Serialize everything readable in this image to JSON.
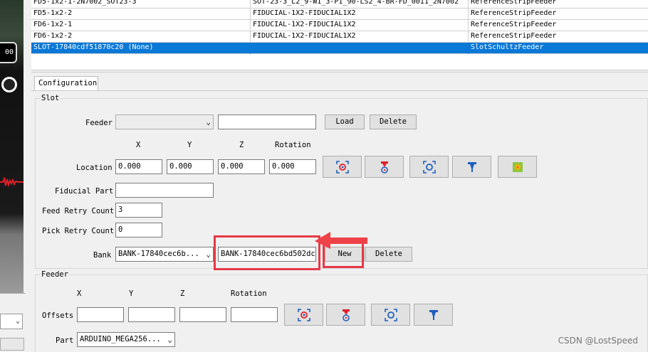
{
  "camera": {
    "zoom_label": "00"
  },
  "feeder_table": {
    "rows": [
      {
        "name": "FD5-1x2-1-2N7002_SOT23-3",
        "part": "SOT-23-3_L2_9-W1_3-P1_90-LS2_4-BR-FD_0011_2N7002",
        "type": "ReferenceStripFeeder",
        "selected": false
      },
      {
        "name": "FD5-1x2-2",
        "part": "FIDUCIAL-1X2-FIDUCIAL1X2",
        "type": "ReferenceStripFeeder",
        "selected": false
      },
      {
        "name": "FD6-1x2-1",
        "part": "FIDUCIAL-1X2-FIDUCIAL1X2",
        "type": "ReferenceStripFeeder",
        "selected": false
      },
      {
        "name": "FD6-1x2-2",
        "part": "FIDUCIAL-1X2-FIDUCIAL1X2",
        "type": "ReferenceStripFeeder",
        "selected": false
      },
      {
        "name": "SLOT-17840cdf51870c20 (None)",
        "part": "",
        "type": "SlotSchultzFeeder",
        "selected": true
      }
    ]
  },
  "tab": {
    "label": "Configuration"
  },
  "slot": {
    "title": "Slot",
    "feeder_label": "Feeder",
    "feeder_value": "",
    "feeder_text": "",
    "load_label": "Load",
    "delete_label": "Delete",
    "col_x": "X",
    "col_y": "Y",
    "col_z": "Z",
    "col_rotation": "Rotation",
    "location_label": "Location",
    "location_x": "0.000",
    "location_y": "0.000",
    "location_z": "0.000",
    "location_rotation": "0.000",
    "fiducial_part_label": "Fiducial Part",
    "fiducial_part_value": "",
    "feed_retry_label": "Feed Retry Count",
    "feed_retry_value": "3",
    "pick_retry_label": "Pick Retry Count",
    "pick_retry_value": "0",
    "bank_label": "Bank",
    "bank_combo_value": "BANK-17840cec6b...",
    "bank_name_value": "BANK-17840cec6bd502dc",
    "new_label": "New",
    "bank_delete_label": "Delete"
  },
  "feeder": {
    "title": "Feeder",
    "col_x": "X",
    "col_y": "Y",
    "col_z": "Z",
    "col_rotation": "Rotation",
    "offsets_label": "Offsets",
    "offset_x": "",
    "offset_y": "",
    "offset_z": "",
    "offset_rotation": "",
    "part_label": "Part",
    "part_value": "ARDUINO_MEGA256..."
  },
  "colors": {
    "selection": "#0a78d7",
    "annotation": "#e63946"
  },
  "watermark": "CSDN @LostSpeed"
}
